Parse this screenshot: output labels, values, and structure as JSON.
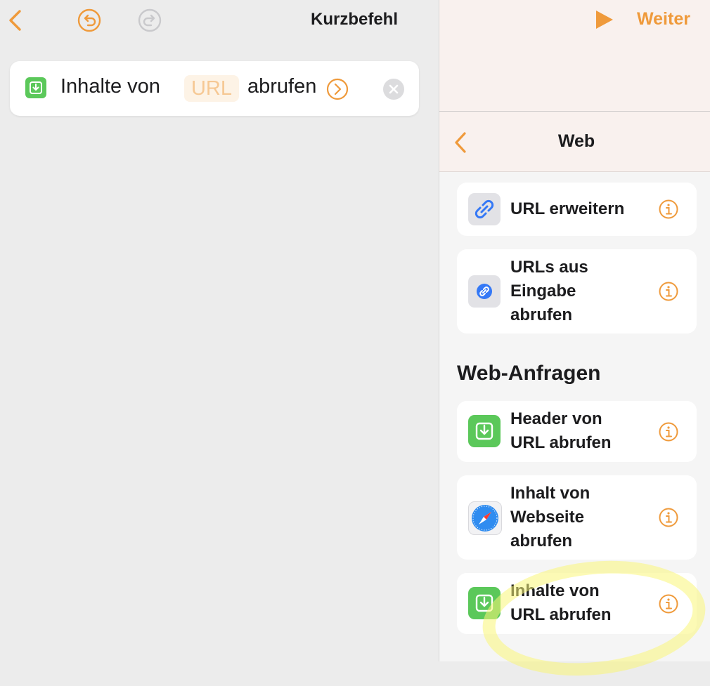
{
  "editor": {
    "title": "Kurzbefehl",
    "action": {
      "prefix": "Inhalte von",
      "token": "URL",
      "suffix": "abrufen"
    }
  },
  "run_bar": {
    "next_label": "Weiter"
  },
  "library": {
    "nav_title": "Web",
    "items_top": [
      {
        "label": "URL erweitern",
        "icon": "link-icon"
      },
      {
        "label": "URLs aus\nEingabe\nabrufen",
        "icon": "link-circle-icon"
      }
    ],
    "section_header": "Web-Anfragen",
    "items_requests": [
      {
        "label": "Header von\nURL abrufen",
        "icon": "download-icon"
      },
      {
        "label": "Inhalt von\nWebseite\nabrufen",
        "icon": "safari-compass-icon"
      },
      {
        "label": "Inhalte von\nURL abrufen",
        "icon": "download-icon"
      }
    ]
  },
  "colors": {
    "accent": "#ef9a3b",
    "green": "#5bc85a",
    "blue": "#3478f6"
  }
}
